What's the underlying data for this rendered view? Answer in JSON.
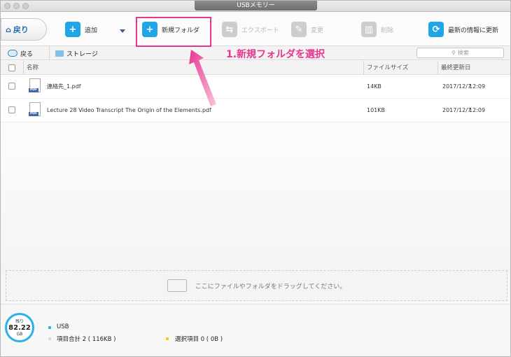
{
  "window": {
    "title": "USBメモリー"
  },
  "toolbar": {
    "back_label": "戻り",
    "add_label": "追加",
    "new_folder_label": "新規フォルダ",
    "export_label": "エクスポート",
    "change_label": "変更",
    "delete_label": "削除",
    "refresh_label": "最新の情報に更新"
  },
  "nav": {
    "back_label": "戻る",
    "breadcrumb": "ストレージ",
    "search_placeholder": "検索"
  },
  "table": {
    "columns": [
      "名称",
      "ファイルサイズ",
      "最終更新日"
    ],
    "rows": [
      {
        "name": "連絡先_1.pdf",
        "size": "14KB",
        "date": "2017/12/7",
        "time": "12:09"
      },
      {
        "name": "Lecture 28 Video Transcript The Origin of the Elements.pdf",
        "size": "101KB",
        "date": "2017/12/7",
        "time": "12:09"
      }
    ]
  },
  "dropzone": {
    "text": "ここにファイルやフォルダをドラッグしてください。"
  },
  "storage": {
    "remaining_label": "残り",
    "value": "82.22",
    "unit": "GB",
    "device_label": "USB",
    "item_total": "項目合計 2 ( 116KB )",
    "selected": "選択項目 0 ( 0B )"
  },
  "annotation": {
    "text": "1.新規フォルダを選択"
  },
  "colors": {
    "accent": "#20a5e8",
    "highlight": "#e8358f",
    "device_dot": "#2bb0ea",
    "selected_dot": "#f5c518"
  }
}
